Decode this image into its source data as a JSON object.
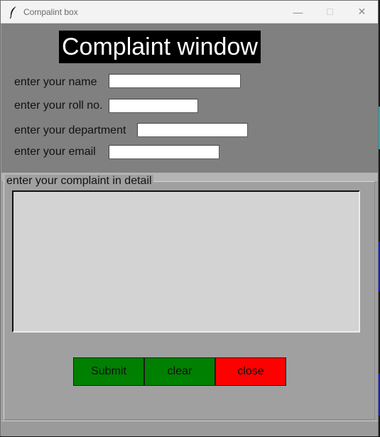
{
  "window": {
    "title": "Compalint box",
    "minimize_glyph": "—",
    "maximize_glyph": "☐",
    "close_glyph": "✕"
  },
  "heading": "Complaint window",
  "fields": [
    {
      "label": "enter your name",
      "value": ""
    },
    {
      "label": "enter your roll no.",
      "value": ""
    },
    {
      "label": "enter your department",
      "value": ""
    },
    {
      "label": "enter your email",
      "value": ""
    }
  ],
  "complaint": {
    "group_label": "enter your complaint in detail",
    "value": ""
  },
  "buttons": {
    "submit": "Submit",
    "clear": "clear",
    "close": "close"
  },
  "colors": {
    "top_panel": "#808080",
    "body": "#a0a0a0",
    "textarea": "#d3d3d3",
    "submit": "#008000",
    "clear": "#008000",
    "close": "#ff0000"
  }
}
